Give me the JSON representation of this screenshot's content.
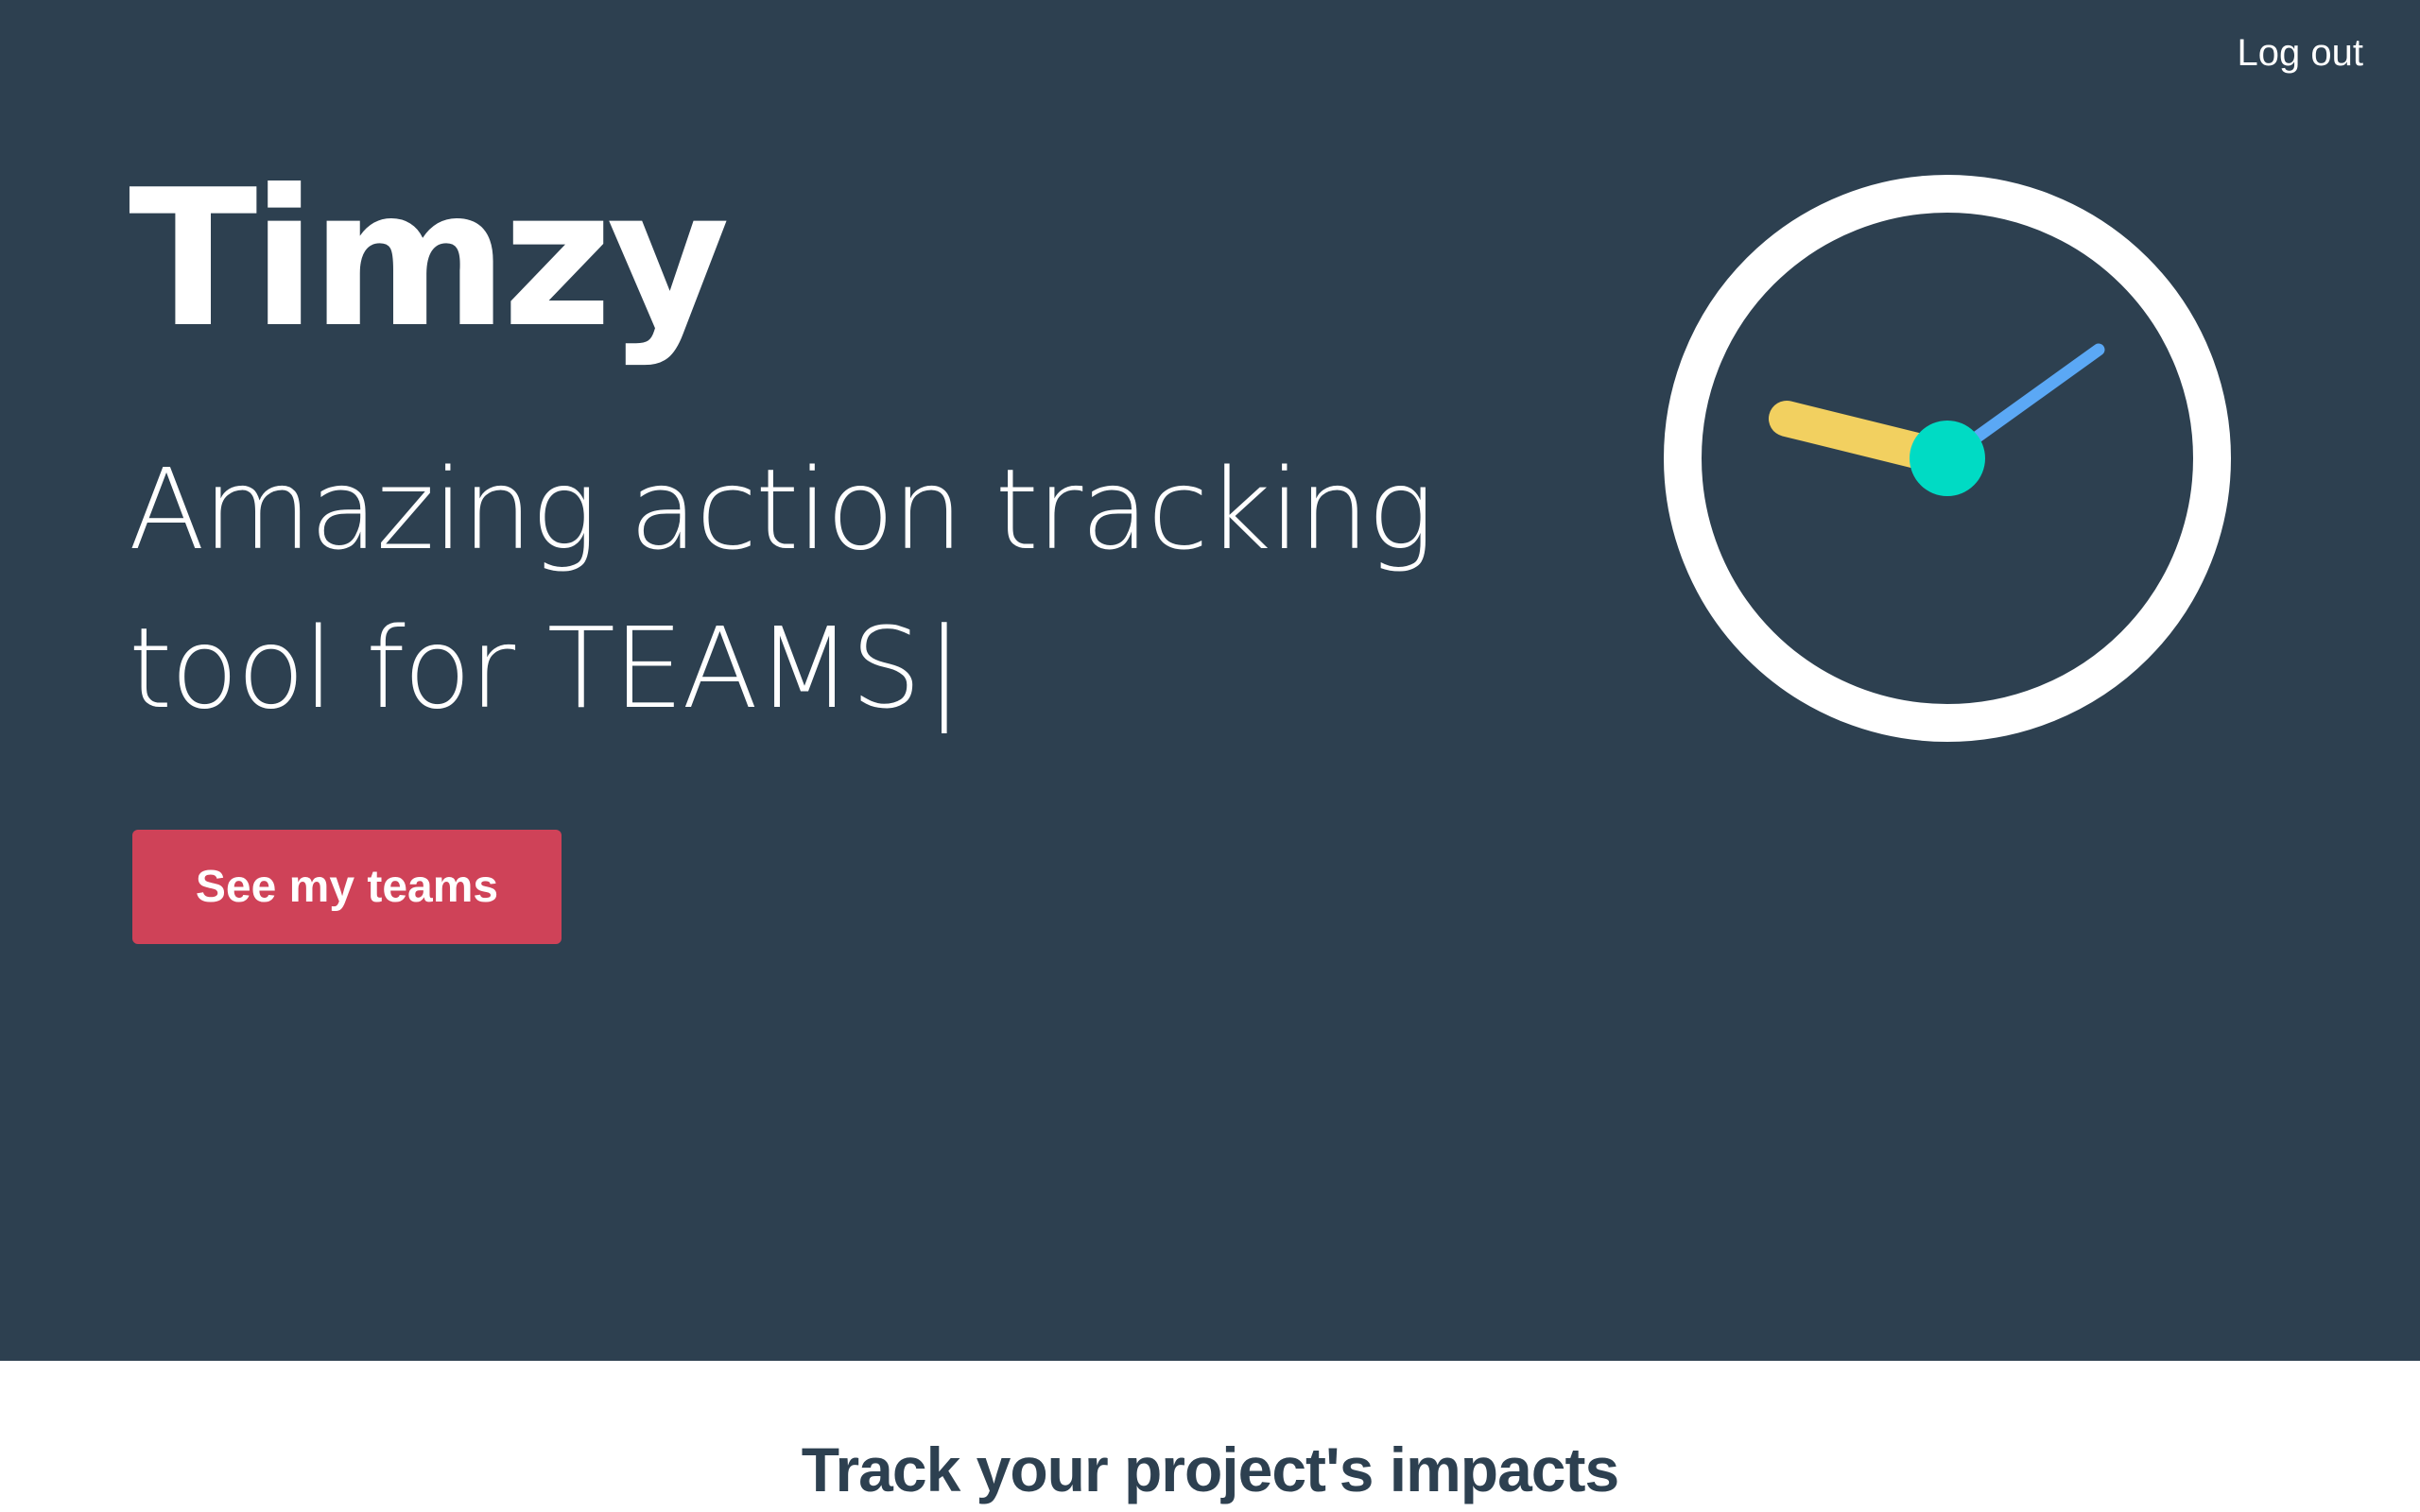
{
  "header": {
    "logout_label": "Log out"
  },
  "hero": {
    "brand": "Timzy",
    "tagline_line1": "Amazing action tracking",
    "tagline_line2": "tool for TEAMS",
    "cursor": "|",
    "cta_label": "See my teams"
  },
  "illustration": {
    "icon": "clock-icon",
    "colors": {
      "face_ring": "#ffffff",
      "hour_hand": "#f2d060",
      "minute_hand": "#5ba8f5",
      "center_dot": "#00dbc4"
    }
  },
  "section": {
    "title": "Track your project's impacts"
  },
  "colors": {
    "hero_background": "#2d4050",
    "cta_background": "#cf4258",
    "text_light": "#ffffff",
    "text_dark": "#2d4050"
  }
}
